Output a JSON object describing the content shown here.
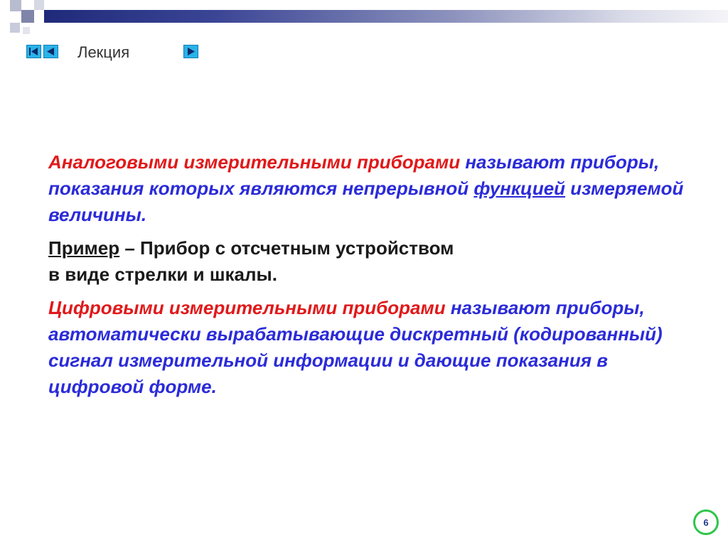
{
  "nav": {
    "lecture_label": "Лекция"
  },
  "colors": {
    "accent_red": "#e0191a",
    "accent_blue": "#2b2bd9",
    "nav_button": "#2bb2e8",
    "badge_ring": "#2ec54c"
  },
  "body": {
    "p1": {
      "term": "Аналоговыми измерительными приборами",
      "text1": " называют приборы, показания которых являются непрерывной ",
      "underlined": "функцией",
      "text2": " измеряемой величины."
    },
    "p2": {
      "label": "Пример",
      "line1": " – Прибор с отсчетным устройством",
      "line2": "в виде стрелки и шкалы."
    },
    "p3": {
      "term": "Цифровыми измерительными приборами",
      "text": " называют приборы, автоматически вырабатывающие дискретный (кодированный) сигнал измерительной информации и дающие показания в цифровой форме."
    }
  },
  "page_number": "6",
  "icons": [
    "first-slide-icon",
    "prev-slide-icon",
    "next-slide-icon"
  ]
}
